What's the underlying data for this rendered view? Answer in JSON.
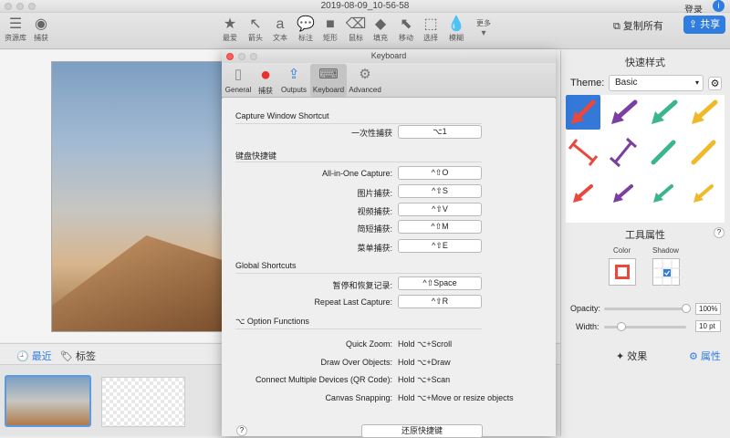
{
  "window": {
    "title": "2019-08-09_10-56-58"
  },
  "header": {
    "login": "登录",
    "info": "i",
    "copy_all": "复制所有",
    "share": "共享"
  },
  "left_tools": [
    {
      "label": "资源库",
      "icon": "☰"
    },
    {
      "label": "捕获",
      "icon": "◉"
    }
  ],
  "tools": [
    {
      "label": "最爱",
      "icon": "★"
    },
    {
      "label": "箭头",
      "icon": "↖"
    },
    {
      "label": "文本",
      "icon": "a"
    },
    {
      "label": "标注",
      "icon": "💬"
    },
    {
      "label": "矩形",
      "icon": "■"
    },
    {
      "label": "鼠标",
      "icon": "⌫"
    },
    {
      "label": "填充",
      "icon": "◆"
    },
    {
      "label": "移动",
      "icon": "⬉"
    },
    {
      "label": "选择",
      "icon": "⬚"
    },
    {
      "label": "模糊",
      "icon": "💧"
    },
    {
      "label": "更多",
      "icon": "▾"
    }
  ],
  "bottom": {
    "recent": "最近",
    "tags": "标签",
    "effects": "效果",
    "properties": "属性"
  },
  "right_panel": {
    "quick_styles_title": "快速样式",
    "theme_label": "Theme:",
    "theme_value": "Basic",
    "tool_props_title": "工具属性",
    "color_label": "Color",
    "shadow_label": "Shadow",
    "opacity_label": "Opacity:",
    "opacity_value": "100%",
    "opacity_level": 1.0,
    "width_label": "Width:",
    "width_value": "10 pt",
    "accent_red": "#e8483d",
    "purple": "#7a3fa0",
    "teal": "#3cb48e",
    "yellow": "#f0b929"
  },
  "dialog": {
    "title": "Keyboard",
    "tabs": [
      {
        "label": "General",
        "icon": "▯"
      },
      {
        "label": "捕获",
        "icon": "●"
      },
      {
        "label": "Outputs",
        "icon": "⇪"
      },
      {
        "label": "Keyboard",
        "icon": "⌨"
      },
      {
        "label": "Advanced",
        "icon": "⚙"
      }
    ],
    "capture_window": {
      "title": "Capture Window Shortcut",
      "rows": [
        {
          "label": "一次性捕获",
          "key": "⌥1"
        }
      ]
    },
    "keyboard_shortcuts": {
      "title": "键盘快捷键",
      "rows": [
        {
          "label": "All-in-One Capture:",
          "key": "^⇧O"
        },
        {
          "label": "图片捕获:",
          "key": "^⇧S"
        },
        {
          "label": "视频捕获:",
          "key": "^⇧V"
        },
        {
          "label": "简短捕获:",
          "key": "^⇧M"
        },
        {
          "label": "菜单捕获:",
          "key": "^⇧E"
        }
      ]
    },
    "global_shortcuts": {
      "title": "Global Shortcuts",
      "rows": [
        {
          "label": "暂停和恢复记录:",
          "key": "^⇧Space"
        },
        {
          "label": "Repeat Last Capture:",
          "key": "^⇧R"
        }
      ]
    },
    "option_functions": {
      "title": "⌥ Option Functions",
      "rows": [
        {
          "label": "Quick Zoom:",
          "value": "Hold ⌥+Scroll"
        },
        {
          "label": "Draw Over Objects:",
          "value": "Hold ⌥+Draw"
        },
        {
          "label": "Connect Multiple Devices (QR Code):",
          "value": "Hold ⌥+Scan"
        },
        {
          "label": "Canvas Snapping:",
          "value": "Hold ⌥+Move or resize objects"
        }
      ]
    },
    "restore_button": "还原快捷键",
    "help": "?"
  }
}
